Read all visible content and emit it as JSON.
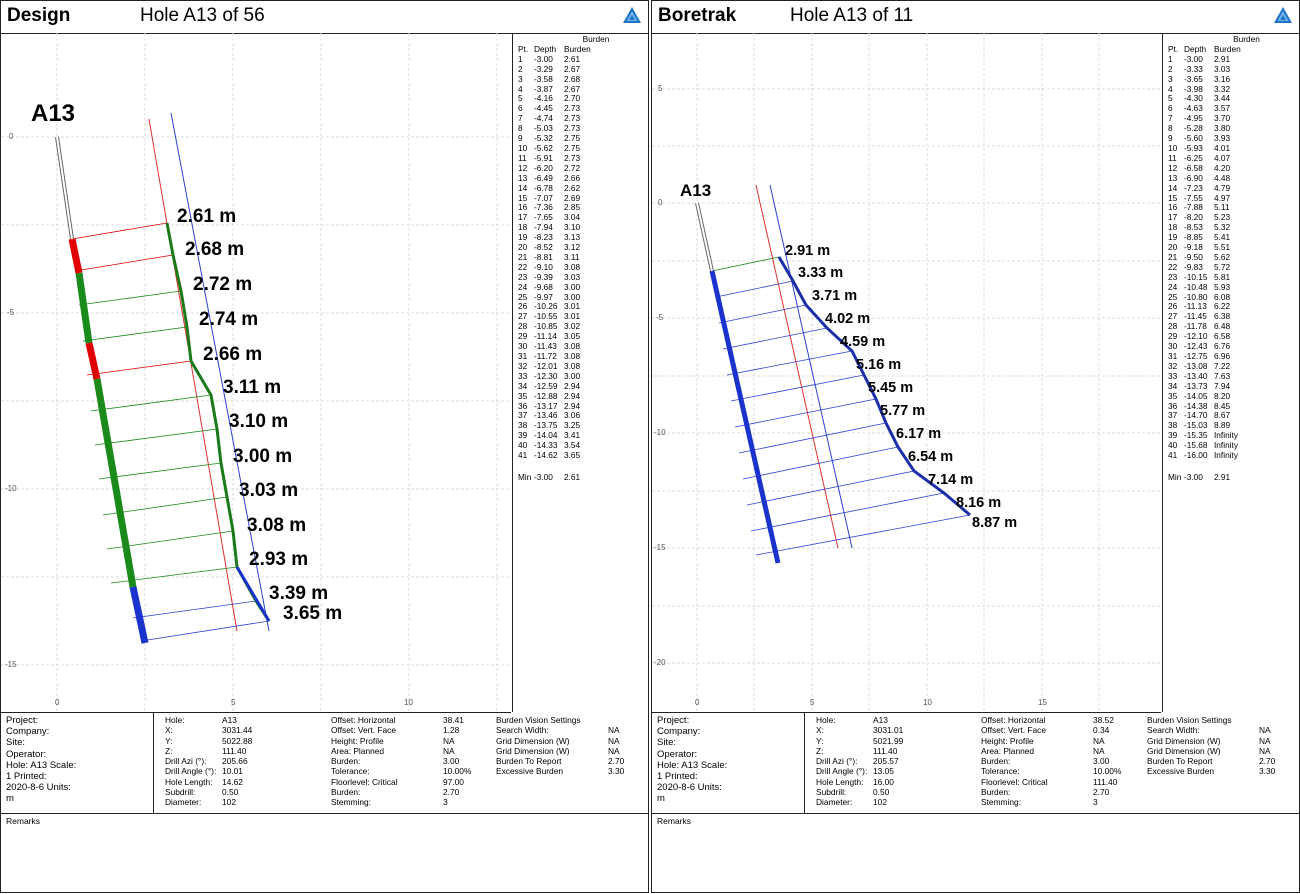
{
  "panels": [
    {
      "name": "Design",
      "hole_label": "Hole A13 of 56",
      "plot": {
        "hole_id": "A13",
        "y_ticks": [
          "0",
          "-5",
          "-10",
          "-15"
        ],
        "x_ticks": [
          "0",
          "5",
          "10"
        ],
        "burden_labels": [
          "2.61 m",
          "2.68 m",
          "2.72 m",
          "2.74 m",
          "2.66 m",
          "3.11 m",
          "3.10 m",
          "3.00 m",
          "3.03 m",
          "3.08 m",
          "2.93 m",
          "3.39 m",
          "3.65 m"
        ]
      },
      "table": {
        "title": "Burden",
        "headers": [
          "Pt.",
          "Depth",
          "Burden"
        ],
        "rows": [
          [
            "1",
            "-3.00",
            "2.61"
          ],
          [
            "2",
            "-3.29",
            "2.67"
          ],
          [
            "3",
            "-3.58",
            "2.68"
          ],
          [
            "4",
            "-3.87",
            "2.67"
          ],
          [
            "5",
            "-4.16",
            "2.70"
          ],
          [
            "6",
            "-4.45",
            "2.73"
          ],
          [
            "7",
            "-4.74",
            "2.73"
          ],
          [
            "8",
            "-5.03",
            "2.73"
          ],
          [
            "9",
            "-5.32",
            "2.75"
          ],
          [
            "10",
            "-5.62",
            "2.75"
          ],
          [
            "11",
            "-5.91",
            "2.73"
          ],
          [
            "12",
            "-6.20",
            "2.72"
          ],
          [
            "13",
            "-6.49",
            "2.66"
          ],
          [
            "14",
            "-6.78",
            "2.62"
          ],
          [
            "15",
            "-7.07",
            "2.69"
          ],
          [
            "16",
            "-7.36",
            "2.85"
          ],
          [
            "17",
            "-7.65",
            "3.04"
          ],
          [
            "18",
            "-7.94",
            "3.10"
          ],
          [
            "19",
            "-8.23",
            "3.13"
          ],
          [
            "20",
            "-8.52",
            "3.12"
          ],
          [
            "21",
            "-8.81",
            "3.11"
          ],
          [
            "22",
            "-9.10",
            "3.08"
          ],
          [
            "23",
            "-9.39",
            "3.03"
          ],
          [
            "24",
            "-9.68",
            "3.00"
          ],
          [
            "25",
            "-9.97",
            "3.00"
          ],
          [
            "26",
            "-10.26",
            "3.01"
          ],
          [
            "27",
            "-10.55",
            "3.01"
          ],
          [
            "28",
            "-10.85",
            "3.02"
          ],
          [
            "29",
            "-11.14",
            "3.05"
          ],
          [
            "30",
            "-11.43",
            "3.08"
          ],
          [
            "31",
            "-11.72",
            "3.08"
          ],
          [
            "32",
            "-12.01",
            "3.08"
          ],
          [
            "33",
            "-12.30",
            "3.00"
          ],
          [
            "34",
            "-12.59",
            "2.94"
          ],
          [
            "35",
            "-12.88",
            "2.94"
          ],
          [
            "36",
            "-13.17",
            "2.94"
          ],
          [
            "37",
            "-13.46",
            "3.06"
          ],
          [
            "38",
            "-13.75",
            "3.25"
          ],
          [
            "39",
            "-14.04",
            "3.41"
          ],
          [
            "40",
            "-14.33",
            "3.54"
          ],
          [
            "41",
            "-14.62",
            "3.65"
          ]
        ],
        "min": [
          "Min",
          "-3.00",
          "2.61"
        ]
      },
      "info": {
        "left": [
          "Project:",
          "Company:",
          "Site:",
          "Operator:",
          "Hole: A13 Scale:",
          "1 Printed:",
          "2020-8-6 Units:",
          "m"
        ],
        "col1": [
          [
            "Hole:",
            "A13"
          ],
          [
            "X:",
            "3031.44"
          ],
          [
            "Y:",
            "5022.88"
          ],
          [
            "Z:",
            "111.40"
          ],
          [
            "Drill Azi (°):",
            "205.66"
          ],
          [
            "Drill Angle (°):",
            "10.01"
          ],
          [
            "Hole Length:",
            "14.62"
          ],
          [
            "Subdrill:",
            "0.50"
          ],
          [
            "Diameter:",
            "102"
          ]
        ],
        "col2": [
          [
            "Offset: Horizontal",
            "38.41"
          ],
          [
            "Offset: Vert. Face",
            "1.28"
          ],
          [
            "Height: Profile",
            "NA"
          ],
          [
            "Area: Planned",
            "NA"
          ],
          [
            "Burden:",
            "3.00"
          ],
          [
            "Tolerance:",
            "10.00%"
          ],
          [
            "Floorlevel: Critical",
            "97.00"
          ],
          [
            "Burden:",
            "2.70"
          ],
          [
            "Stemming:",
            "3"
          ]
        ],
        "col3": [
          [
            "Burden Vision Settings",
            ""
          ],
          [
            "Search Width:",
            "NA"
          ],
          [
            "Grid Dimension (W)",
            "NA"
          ],
          [
            "Grid Dimension (W)",
            "NA"
          ],
          [
            "Burden To Report",
            "2.70"
          ],
          [
            "Excessive Burden",
            "3.30"
          ]
        ]
      },
      "remarks": "Remarks"
    },
    {
      "name": "Boretrak",
      "hole_label": "Hole A13 of 11",
      "plot": {
        "hole_id": "A13",
        "y_ticks": [
          "5",
          "0",
          "-5",
          "-10",
          "-15",
          "-20"
        ],
        "x_ticks": [
          "0",
          "5",
          "10",
          "15"
        ],
        "burden_labels": [
          "2.91 m",
          "3.33 m",
          "3.71 m",
          "4.02 m",
          "4.59 m",
          "5.16 m",
          "5.45 m",
          "5.77 m",
          "6.17 m",
          "6.54 m",
          "7.14 m",
          "8.16 m",
          "8.87 m"
        ]
      },
      "table": {
        "title": "Burden",
        "headers": [
          "Pt.",
          "Depth",
          "Burden"
        ],
        "rows": [
          [
            "1",
            "-3.00",
            "2.91"
          ],
          [
            "2",
            "-3.33",
            "3.03"
          ],
          [
            "3",
            "-3.65",
            "3.16"
          ],
          [
            "4",
            "-3.98",
            "3.32"
          ],
          [
            "5",
            "-4.30",
            "3.44"
          ],
          [
            "6",
            "-4.63",
            "3.57"
          ],
          [
            "7",
            "-4.95",
            "3.70"
          ],
          [
            "8",
            "-5.28",
            "3.80"
          ],
          [
            "9",
            "-5.60",
            "3.93"
          ],
          [
            "10",
            "-5.93",
            "4.01"
          ],
          [
            "11",
            "-6.25",
            "4.07"
          ],
          [
            "12",
            "-6.58",
            "4.20"
          ],
          [
            "13",
            "-6.90",
            "4.48"
          ],
          [
            "14",
            "-7.23",
            "4.79"
          ],
          [
            "15",
            "-7.55",
            "4.97"
          ],
          [
            "16",
            "-7.88",
            "5.11"
          ],
          [
            "17",
            "-8.20",
            "5.23"
          ],
          [
            "18",
            "-8.53",
            "5.32"
          ],
          [
            "19",
            "-8.85",
            "5.41"
          ],
          [
            "20",
            "-9.18",
            "5.51"
          ],
          [
            "21",
            "-9.50",
            "5.62"
          ],
          [
            "22",
            "-9.83",
            "5.72"
          ],
          [
            "23",
            "-10.15",
            "5.81"
          ],
          [
            "24",
            "-10.48",
            "5.93"
          ],
          [
            "25",
            "-10.80",
            "6.08"
          ],
          [
            "26",
            "-11.13",
            "6.22"
          ],
          [
            "27",
            "-11.45",
            "6.38"
          ],
          [
            "28",
            "-11.78",
            "6.48"
          ],
          [
            "29",
            "-12.10",
            "6.58"
          ],
          [
            "30",
            "-12.43",
            "6.76"
          ],
          [
            "31",
            "-12.75",
            "6.96"
          ],
          [
            "32",
            "-13.08",
            "7.22"
          ],
          [
            "33",
            "-13.40",
            "7.63"
          ],
          [
            "34",
            "-13.73",
            "7.94"
          ],
          [
            "35",
            "-14.05",
            "8.20"
          ],
          [
            "36",
            "-14.38",
            "8.45"
          ],
          [
            "37",
            "-14.70",
            "8.67"
          ],
          [
            "38",
            "-15.03",
            "8.89"
          ],
          [
            "39",
            "-15.35",
            "Infinity"
          ],
          [
            "40",
            "-15.68",
            "Infinity"
          ],
          [
            "41",
            "-16.00",
            "Infinity"
          ]
        ],
        "min": [
          "Min",
          "-3.00",
          "2.91"
        ]
      },
      "info": {
        "left": [
          "Project:",
          "Company:",
          "Site:",
          "Operator:",
          "Hole: A13 Scale:",
          "1 Printed:",
          "2020-8-6 Units:",
          "m"
        ],
        "col1": [
          [
            "Hole:",
            "A13"
          ],
          [
            "X:",
            "3031.01"
          ],
          [
            "Y:",
            "5021.99"
          ],
          [
            "Z:",
            "111.40"
          ],
          [
            "Drill Azi (°):",
            "205.57"
          ],
          [
            "Drill Angle (°):",
            "13.05"
          ],
          [
            "Hole Length:",
            "16.00"
          ],
          [
            "Subdrill:",
            "0.50"
          ],
          [
            "Diameter:",
            "102"
          ]
        ],
        "col2": [
          [
            "Offset: Horizontal",
            "38.52"
          ],
          [
            "Offset: Vert. Face",
            "0.34"
          ],
          [
            "Height: Profile",
            "NA"
          ],
          [
            "Area: Planned",
            "NA"
          ],
          [
            "Burden:",
            "3.00"
          ],
          [
            "Tolerance:",
            "10.00%"
          ],
          [
            "Floorlevel: Critical",
            "111.40"
          ],
          [
            "Burden:",
            "2.70"
          ],
          [
            "Stemming:",
            "3"
          ]
        ],
        "col3": [
          [
            "Burden Vision Settings",
            ""
          ],
          [
            "Search Width:",
            "NA"
          ],
          [
            "Grid Dimension (W)",
            "NA"
          ],
          [
            "Grid Dimension (W)",
            "NA"
          ],
          [
            "Burden To Report",
            "2.70"
          ],
          [
            "Excessive Burden",
            "3.30"
          ]
        ]
      },
      "remarks": "Remarks"
    }
  ],
  "colors": {
    "red": "#e00000",
    "green": "#1a8a1a",
    "blue": "#1a33cc",
    "darkblue": "#1a2fa8",
    "grid": "#d9d9d9"
  }
}
